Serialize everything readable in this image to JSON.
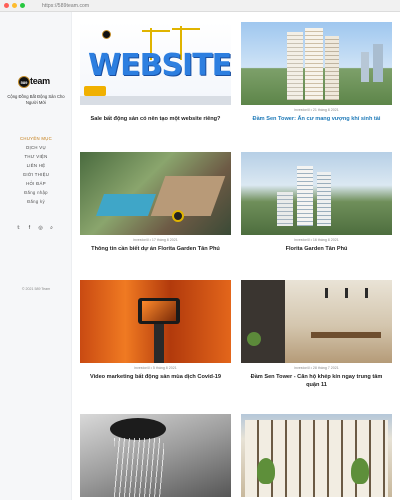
{
  "browser": {
    "url": "https://589team.com"
  },
  "sidebar": {
    "logo_badge": "589",
    "logo_word": "team",
    "tagline": "Cộng Đồng Bất Động Sản Cho Người Mới",
    "menu": [
      {
        "label": "CHUYÊN MỤC",
        "active": true
      },
      {
        "label": "DỊCH VỤ",
        "active": false
      },
      {
        "label": "THƯ VIỆN",
        "active": false
      },
      {
        "label": "LIÊN HỆ",
        "active": false
      },
      {
        "label": "GIỚI THIỆU",
        "active": false
      },
      {
        "label": "HỎI ĐÁP",
        "active": false
      },
      {
        "label": "Đăng nhập",
        "active": false
      },
      {
        "label": "Đăng ký",
        "active": false
      }
    ],
    "social_icons": [
      "twitter-icon",
      "facebook-icon",
      "instagram-icon",
      "search-icon"
    ],
    "social_glyphs": [
      "𝕥",
      "f",
      "◎",
      "⌕"
    ],
    "copyright": "© 2021 589 Team"
  },
  "posts": [
    {
      "meta": "",
      "title": "Sale bất động sản có nên tạo một website riêng?",
      "highlight": false,
      "logo_text": "589 team",
      "logo_title": "WEBSITE"
    },
    {
      "meta": "investor4l • 21 tháng 8 2021",
      "title": "Đầm Sen Tower: Ấn cư mang vượng khí sinh tài",
      "highlight": true
    },
    {
      "meta": "investor4l • 17 tháng 8 2021",
      "title": "Thông tin cần biết dự án Florita Garden Tân Phú",
      "highlight": false
    },
    {
      "meta": "investor4l • 16 tháng 8 2021",
      "title": "Florita Garden Tân Phú",
      "highlight": false
    },
    {
      "meta": "investor4l • 5 tháng 8 2021",
      "title": "Video marketing bất động sản mùa dịch Covid-19",
      "highlight": false
    },
    {
      "meta": "investor4l • 28 tháng 7 2021",
      "title": "Đầm Sen Tower - Căn hộ khép kín ngay trung tâm quận 11",
      "highlight": false
    },
    {
      "meta": "",
      "title": "",
      "highlight": false
    },
    {
      "meta": "",
      "title": "",
      "highlight": false
    }
  ],
  "colors": {
    "accent": "#c47a10",
    "link": "#1f7ab8",
    "sidebar_bg": "#f6f7f9"
  }
}
